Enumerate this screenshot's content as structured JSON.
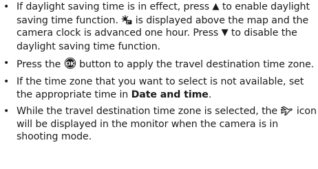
{
  "bullets": [
    {
      "t1": "If daylight saving time is in effect, press ",
      "up_symbol": "▲",
      "t2": " to enable daylight saving time function. ",
      "icon": "daylight-saving-icon",
      "t3": " is displayed above the map and the camera clock is advanced one hour. Press ",
      "down_symbol": "▼",
      "t4": " to disable the daylight saving time function."
    },
    {
      "t1": "Press the ",
      "icon": "ok-button-icon",
      "t2": " button to apply the travel destination time zone."
    },
    {
      "t1": "If the time zone that you want to select is not available, set the appropriate time in ",
      "bold": "Date and time",
      "t2": "."
    },
    {
      "t1": "While the travel destination time zone is selected, the ",
      "icon": "travel-destination-icon",
      "t2": " icon will be displayed in the monitor when the camera is in shooting mode."
    }
  ],
  "bullet_char": "•"
}
